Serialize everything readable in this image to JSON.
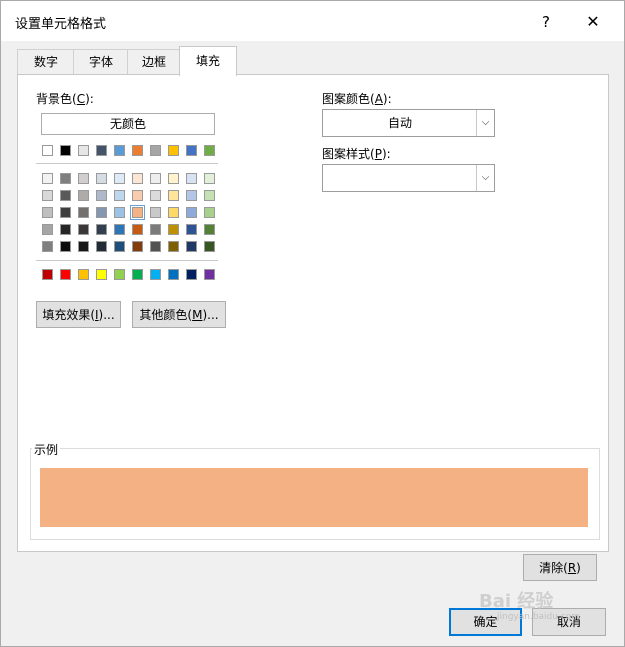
{
  "dialog": {
    "title": "设置单元格格式",
    "help": "?",
    "close": "✕"
  },
  "tabs": [
    {
      "label": "数字"
    },
    {
      "label": "字体"
    },
    {
      "label": "边框"
    },
    {
      "label": "填充",
      "active": true
    }
  ],
  "background": {
    "label_pre": "背景色(",
    "label_key": "C",
    "label_post": "):",
    "no_color": "无颜色",
    "theme_top": [
      "#ffffff",
      "#000000",
      "#e7e6e6",
      "#44546a",
      "#5b9bd5",
      "#ed7d31",
      "#a5a5a5",
      "#ffc000",
      "#4472c4",
      "#70ad47"
    ],
    "theme_shades": [
      [
        "#f2f2f2",
        "#7f7f7f",
        "#d0cece",
        "#d6dce4",
        "#deebf6",
        "#fbe5d5",
        "#ededed",
        "#fff2cc",
        "#d9e2f3",
        "#e2efd9"
      ],
      [
        "#d8d8d8",
        "#595959",
        "#aeabab",
        "#adb9ca",
        "#bdd7ee",
        "#f7cbac",
        "#dbdbdb",
        "#fee599",
        "#b4c6e7",
        "#c5e0b3"
      ],
      [
        "#bfbfbf",
        "#3f3f3f",
        "#757070",
        "#8496b0",
        "#9cc3e5",
        "#f4b183",
        "#c9c9c9",
        "#ffd965",
        "#8eaadb",
        "#a8d08d"
      ],
      [
        "#a5a5a5",
        "#262626",
        "#3a3838",
        "#323f4f",
        "#2e75b5",
        "#c55a11",
        "#7b7b7b",
        "#bf9000",
        "#2f5496",
        "#538135"
      ],
      [
        "#7f7f7f",
        "#0c0c0c",
        "#171616",
        "#222a35",
        "#1e4e79",
        "#833c0b",
        "#525252",
        "#7f6000",
        "#1f3864",
        "#375623"
      ]
    ],
    "standard": [
      "#c00000",
      "#ff0000",
      "#ffc000",
      "#ffff00",
      "#92d050",
      "#00b050",
      "#00b0f0",
      "#0070c0",
      "#002060",
      "#7030a0"
    ],
    "selected_color": "#f4b183",
    "fill_effects_pre": "填充效果(",
    "fill_effects_key": "I",
    "fill_effects_post": ")...",
    "more_colors_pre": "其他颜色(",
    "more_colors_key": "M",
    "more_colors_post": ")..."
  },
  "pattern": {
    "color_label_pre": "图案颜色(",
    "color_label_key": "A",
    "color_label_post": "):",
    "color_value": "自动",
    "style_label_pre": "图案样式(",
    "style_label_key": "P",
    "style_label_post": "):",
    "style_value": ""
  },
  "sample": {
    "label": "示例",
    "fill": "#f4b183"
  },
  "buttons": {
    "clear_pre": "清除(",
    "clear_key": "R",
    "clear_post": ")",
    "ok": "确定",
    "cancel": "取消"
  },
  "watermark": {
    "text": "Bai 经验",
    "sub": "jingyan.baidu.com"
  }
}
